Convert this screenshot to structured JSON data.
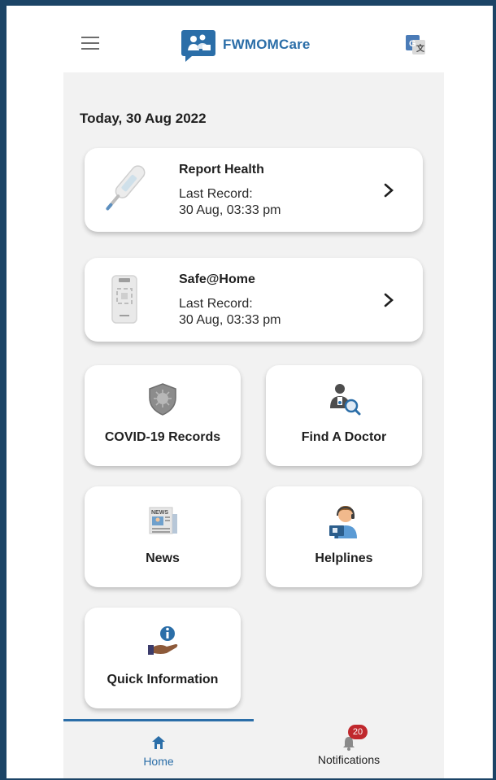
{
  "header": {
    "app_name": "FWMOMCare"
  },
  "main": {
    "date": "Today, 30 Aug 2022",
    "cards": [
      {
        "title": "Report Health",
        "last_record_label": "Last Record:",
        "last_record_value": "30 Aug, 03:33 pm",
        "icon": "thermometer-icon"
      },
      {
        "title": "Safe@Home",
        "last_record_label": "Last Record:",
        "last_record_value": "30 Aug, 03:33 pm",
        "icon": "device-scan-icon"
      }
    ],
    "tiles": [
      {
        "label": "COVID-19 Records",
        "icon": "virus-shield-icon"
      },
      {
        "label": "Find A Doctor",
        "icon": "doctor-search-icon"
      },
      {
        "label": "News",
        "icon": "newspaper-icon"
      },
      {
        "label": "Helplines",
        "icon": "helpline-agent-icon"
      },
      {
        "label": "Quick Information",
        "icon": "info-hand-icon"
      }
    ]
  },
  "bottom_nav": {
    "items": [
      {
        "label": "Home",
        "icon": "home-icon",
        "active": true
      },
      {
        "label": "Notifications",
        "icon": "bell-icon",
        "badge": "20"
      }
    ]
  },
  "colors": {
    "accent": "#2b6ea8",
    "badge": "#c0282d",
    "background": "#f2f2f2",
    "frame": "#1c4466"
  }
}
